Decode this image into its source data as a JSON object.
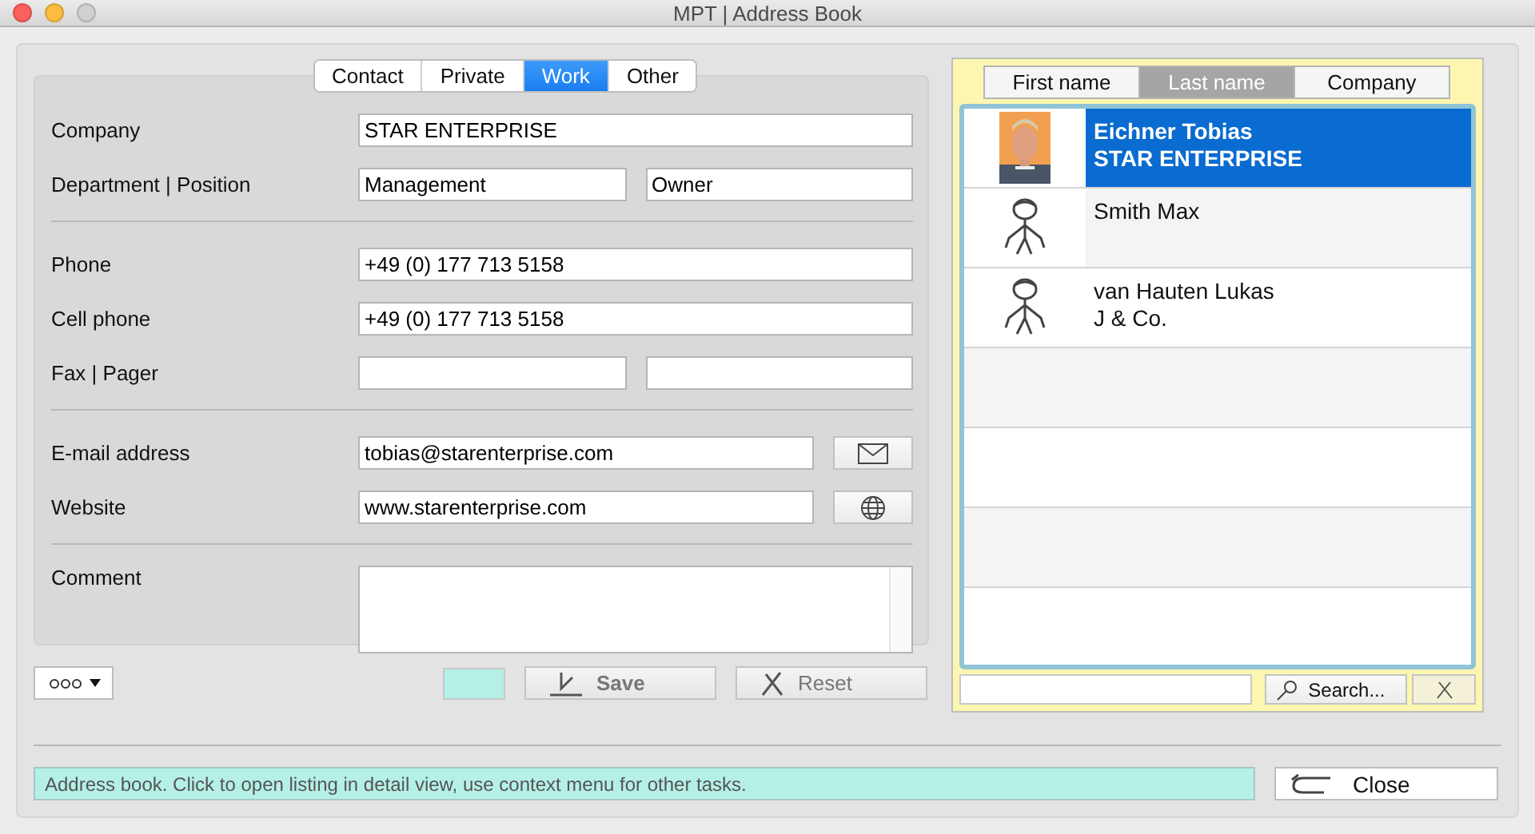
{
  "window": {
    "title": "MPT | Address Book"
  },
  "tabs": [
    {
      "label": "Contact",
      "selected": false
    },
    {
      "label": "Private",
      "selected": false
    },
    {
      "label": "Work",
      "selected": true
    },
    {
      "label": "Other",
      "selected": false
    }
  ],
  "form": {
    "groups": [
      [
        {
          "kind": "text",
          "label": "Company",
          "fields": [
            {
              "kind": "entry",
              "value": "STAR ENTERPRISE"
            }
          ]
        },
        {
          "kind": "text",
          "label": "Department | Position",
          "fields": [
            {
              "kind": "entry",
              "value": "Management"
            },
            {
              "kind": "entry",
              "value": "Owner"
            }
          ]
        }
      ],
      [
        {
          "kind": "text",
          "label": "Phone",
          "fields": [
            {
              "kind": "entry",
              "value": "+49 (0) 177 713 5158"
            }
          ]
        },
        {
          "kind": "text",
          "label": "Cell phone",
          "fields": [
            {
              "kind": "entry",
              "value": "+49 (0) 177 713 5158"
            }
          ]
        },
        {
          "kind": "text",
          "label": "Fax | Pager",
          "fields": [
            {
              "kind": "blank"
            },
            {
              "kind": "blank"
            }
          ]
        }
      ],
      [
        {
          "kind": "email",
          "label": "E-mail address",
          "fields": [
            {
              "kind": "entry",
              "value": "tobias@starenterprise.com"
            }
          ]
        },
        {
          "kind": "web",
          "label": "Website",
          "fields": [
            {
              "kind": "entry",
              "value": "www.starenterprise.com"
            }
          ]
        }
      ]
    ],
    "comment_label": "Comment"
  },
  "buttons": {
    "save": {
      "label": "Save",
      "disabled": true
    },
    "reset": {
      "label": "Reset",
      "disabled": true
    }
  },
  "swatch": {
    "color": "#b4f0e6"
  },
  "list": {
    "columns": [
      {
        "label": "First name",
        "selected": false
      },
      {
        "label": "Last name",
        "selected": true
      },
      {
        "label": "Company",
        "selected": false
      }
    ],
    "rows": [
      {
        "name": "Eichner Tobias",
        "company": "STAR ENTERPRISE",
        "selected": true
      },
      {
        "kind": "figure",
        "name": "Smith Max",
        "selected": false
      },
      {
        "kind": "figure",
        "name": "van Hauten Lukas",
        "company": "J & Co.",
        "selected": false
      }
    ],
    "search_label": "Search..."
  },
  "status_bar": "Address book. Click to open listing in detail view, use context menu for other tasks.",
  "close_label": "Close"
}
